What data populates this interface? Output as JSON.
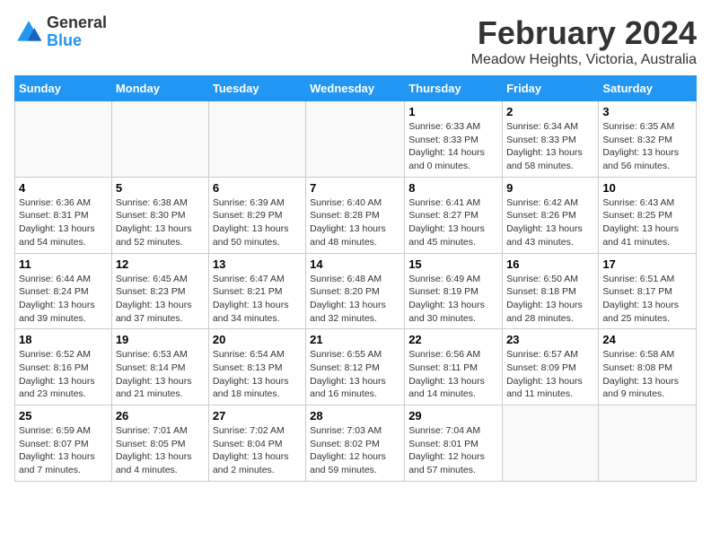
{
  "logo": {
    "line1": "General",
    "line2": "Blue"
  },
  "title": "February 2024",
  "subtitle": "Meadow Heights, Victoria, Australia",
  "weekdays": [
    "Sunday",
    "Monday",
    "Tuesday",
    "Wednesday",
    "Thursday",
    "Friday",
    "Saturday"
  ],
  "weeks": [
    [
      {
        "day": "",
        "info": ""
      },
      {
        "day": "",
        "info": ""
      },
      {
        "day": "",
        "info": ""
      },
      {
        "day": "",
        "info": ""
      },
      {
        "day": "1",
        "info": "Sunrise: 6:33 AM\nSunset: 8:33 PM\nDaylight: 14 hours\nand 0 minutes."
      },
      {
        "day": "2",
        "info": "Sunrise: 6:34 AM\nSunset: 8:33 PM\nDaylight: 13 hours\nand 58 minutes."
      },
      {
        "day": "3",
        "info": "Sunrise: 6:35 AM\nSunset: 8:32 PM\nDaylight: 13 hours\nand 56 minutes."
      }
    ],
    [
      {
        "day": "4",
        "info": "Sunrise: 6:36 AM\nSunset: 8:31 PM\nDaylight: 13 hours\nand 54 minutes."
      },
      {
        "day": "5",
        "info": "Sunrise: 6:38 AM\nSunset: 8:30 PM\nDaylight: 13 hours\nand 52 minutes."
      },
      {
        "day": "6",
        "info": "Sunrise: 6:39 AM\nSunset: 8:29 PM\nDaylight: 13 hours\nand 50 minutes."
      },
      {
        "day": "7",
        "info": "Sunrise: 6:40 AM\nSunset: 8:28 PM\nDaylight: 13 hours\nand 48 minutes."
      },
      {
        "day": "8",
        "info": "Sunrise: 6:41 AM\nSunset: 8:27 PM\nDaylight: 13 hours\nand 45 minutes."
      },
      {
        "day": "9",
        "info": "Sunrise: 6:42 AM\nSunset: 8:26 PM\nDaylight: 13 hours\nand 43 minutes."
      },
      {
        "day": "10",
        "info": "Sunrise: 6:43 AM\nSunset: 8:25 PM\nDaylight: 13 hours\nand 41 minutes."
      }
    ],
    [
      {
        "day": "11",
        "info": "Sunrise: 6:44 AM\nSunset: 8:24 PM\nDaylight: 13 hours\nand 39 minutes."
      },
      {
        "day": "12",
        "info": "Sunrise: 6:45 AM\nSunset: 8:23 PM\nDaylight: 13 hours\nand 37 minutes."
      },
      {
        "day": "13",
        "info": "Sunrise: 6:47 AM\nSunset: 8:21 PM\nDaylight: 13 hours\nand 34 minutes."
      },
      {
        "day": "14",
        "info": "Sunrise: 6:48 AM\nSunset: 8:20 PM\nDaylight: 13 hours\nand 32 minutes."
      },
      {
        "day": "15",
        "info": "Sunrise: 6:49 AM\nSunset: 8:19 PM\nDaylight: 13 hours\nand 30 minutes."
      },
      {
        "day": "16",
        "info": "Sunrise: 6:50 AM\nSunset: 8:18 PM\nDaylight: 13 hours\nand 28 minutes."
      },
      {
        "day": "17",
        "info": "Sunrise: 6:51 AM\nSunset: 8:17 PM\nDaylight: 13 hours\nand 25 minutes."
      }
    ],
    [
      {
        "day": "18",
        "info": "Sunrise: 6:52 AM\nSunset: 8:16 PM\nDaylight: 13 hours\nand 23 minutes."
      },
      {
        "day": "19",
        "info": "Sunrise: 6:53 AM\nSunset: 8:14 PM\nDaylight: 13 hours\nand 21 minutes."
      },
      {
        "day": "20",
        "info": "Sunrise: 6:54 AM\nSunset: 8:13 PM\nDaylight: 13 hours\nand 18 minutes."
      },
      {
        "day": "21",
        "info": "Sunrise: 6:55 AM\nSunset: 8:12 PM\nDaylight: 13 hours\nand 16 minutes."
      },
      {
        "day": "22",
        "info": "Sunrise: 6:56 AM\nSunset: 8:11 PM\nDaylight: 13 hours\nand 14 minutes."
      },
      {
        "day": "23",
        "info": "Sunrise: 6:57 AM\nSunset: 8:09 PM\nDaylight: 13 hours\nand 11 minutes."
      },
      {
        "day": "24",
        "info": "Sunrise: 6:58 AM\nSunset: 8:08 PM\nDaylight: 13 hours\nand 9 minutes."
      }
    ],
    [
      {
        "day": "25",
        "info": "Sunrise: 6:59 AM\nSunset: 8:07 PM\nDaylight: 13 hours\nand 7 minutes."
      },
      {
        "day": "26",
        "info": "Sunrise: 7:01 AM\nSunset: 8:05 PM\nDaylight: 13 hours\nand 4 minutes."
      },
      {
        "day": "27",
        "info": "Sunrise: 7:02 AM\nSunset: 8:04 PM\nDaylight: 13 hours\nand 2 minutes."
      },
      {
        "day": "28",
        "info": "Sunrise: 7:03 AM\nSunset: 8:02 PM\nDaylight: 12 hours\nand 59 minutes."
      },
      {
        "day": "29",
        "info": "Sunrise: 7:04 AM\nSunset: 8:01 PM\nDaylight: 12 hours\nand 57 minutes."
      },
      {
        "day": "",
        "info": ""
      },
      {
        "day": "",
        "info": ""
      }
    ]
  ]
}
